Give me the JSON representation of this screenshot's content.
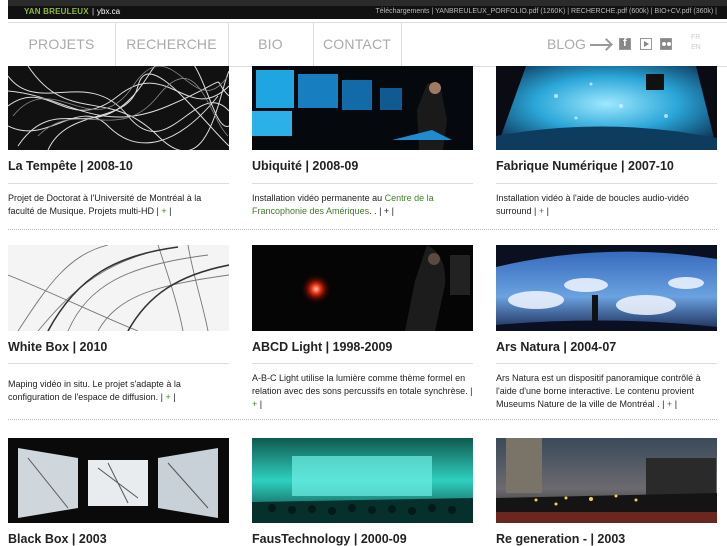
{
  "header": {
    "site_name": "YAN BREULEUX",
    "separator": "|",
    "site_url": "ybx.ca",
    "downloads": "Téléchargements  | YANBREULEUX_PORFOLIO.pdf (1260K)  |  RECHERCHE.pdf (600k)  |  BIO+CV.pdf (360k)  |"
  },
  "nav": {
    "items": [
      "PROJETS",
      "RECHERCHE",
      "BIO",
      "CONTACT"
    ],
    "blog": "BLOG",
    "lang_fr": "FR",
    "lang_en": "EN"
  },
  "projects": [
    {
      "title": "La Tempête | 2008-10",
      "desc_pre": "Projet de Doctorat à l'Université de Montréal à la faculté de Musique. Projets multi-HD | ",
      "link": "+",
      "desc_post": " |"
    },
    {
      "title": "Ubiquité | 2008-09",
      "desc_pre": "Installation vidéo permanente au ",
      "link": "Centre de la Francophonie des Amériques",
      "desc_post": ". . | + |"
    },
    {
      "title": "Fabrique Numérique | 2007-10",
      "desc_pre": "Installation vidéo à l'aide de boucles audio-vidéo surround | ",
      "link": "+",
      "desc_post": " |"
    },
    {
      "title": "White Box | 2010",
      "desc_pre": "Maping vidéo in situ. Le projet s'adapte à la configuration de l'espace de diffusion. | ",
      "link": "+",
      "desc_post": " |"
    },
    {
      "title": "ABCD Light | 1998-2009",
      "desc_pre": "A-B-C Light utilise la lumière comme thème formel en relation avec des sons percussifs en totale synchrèse. | ",
      "link": "+",
      "desc_post": " |"
    },
    {
      "title": "Ars Natura | 2004-07",
      "desc_pre": "Ars Natura est un dispositif panoramique contrôlé à l'aide d'une borne interactive. Le contenu provient Museums Nature de la ville de Montréal . | ",
      "link": "+",
      "desc_post": " |"
    },
    {
      "title": "Black Box | 2003",
      "desc_pre": "",
      "link": "",
      "desc_post": ""
    },
    {
      "title": "FausTechnology | 2000-09",
      "desc_pre": "",
      "link": "",
      "desc_post": ""
    },
    {
      "title": "Re generation - | 2003",
      "desc_pre": "",
      "link": "",
      "desc_post": ""
    }
  ]
}
